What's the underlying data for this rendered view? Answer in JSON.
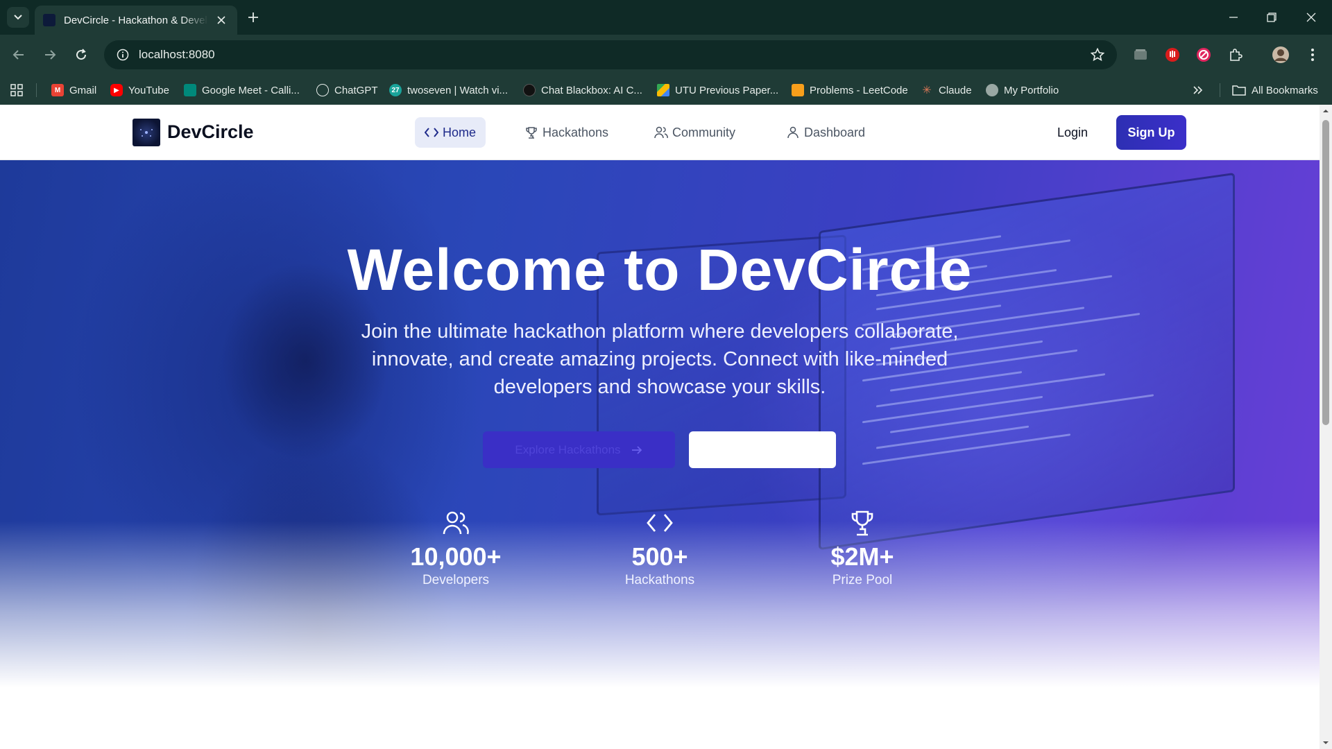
{
  "browser": {
    "tab_title": "DevCircle - Hackathon & Developer Community",
    "url": "localhost:8080",
    "bookmarks": [
      {
        "label": "Gmail",
        "color": "#ea4335"
      },
      {
        "label": "YouTube",
        "color": "#ff0000"
      },
      {
        "label": "Google Meet - Calli...",
        "color": "#00897b"
      },
      {
        "label": "ChatGPT",
        "color": "#6b7c78"
      },
      {
        "label": "twoseven | Watch vi...",
        "color": "#1aa39a"
      },
      {
        "label": "Chat Blackbox: AI C...",
        "color": "#111111"
      },
      {
        "label": "UTU Previous Paper...",
        "color": "#34a853"
      },
      {
        "label": "Problems - LeetCode",
        "color": "#f89f1b"
      },
      {
        "label": "Claude",
        "color": "#d97757"
      },
      {
        "label": "My Portfolio",
        "color": "#9aa8a4"
      }
    ],
    "all_bookmarks_label": "All Bookmarks"
  },
  "site": {
    "brand": "DevCircle",
    "nav": {
      "home": "Home",
      "hackathons": "Hackathons",
      "community": "Community",
      "dashboard": "Dashboard"
    },
    "login": "Login",
    "signup": "Sign Up"
  },
  "hero": {
    "title": "Welcome to DevCircle",
    "subtitle": "Join the ultimate hackathon platform where developers collaborate, innovate, and create amazing projects. Connect with like-minded developers and showcase your skills.",
    "primary_button": "Explore Hackathons",
    "secondary_button": ""
  },
  "stats": [
    {
      "icon": "users-icon",
      "value": "10,000+",
      "label": "Developers"
    },
    {
      "icon": "code-icon",
      "value": "500+",
      "label": "Hackathons"
    },
    {
      "icon": "trophy-icon",
      "value": "$2M+",
      "label": "Prize Pool"
    }
  ],
  "colors": {
    "accent": "#3a2fc6",
    "chrome": "#1f3b36",
    "nav_active_bg": "#e7ebf8"
  }
}
